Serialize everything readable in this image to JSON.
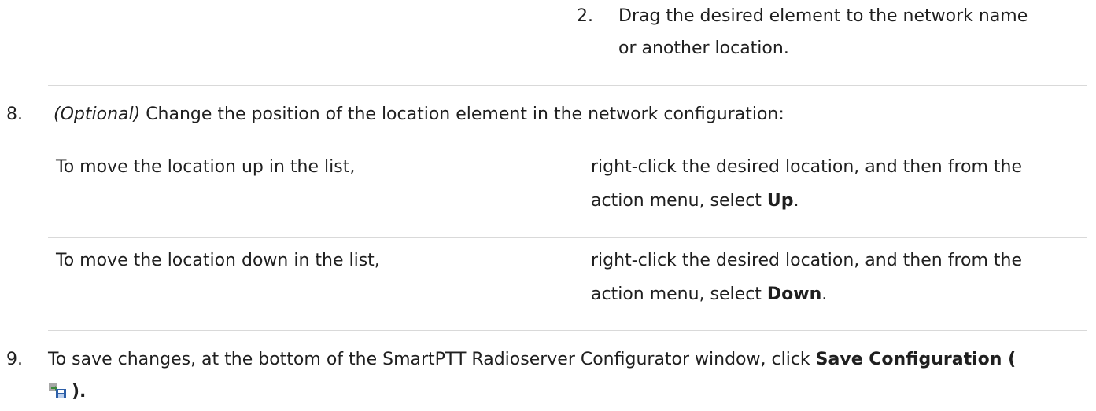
{
  "step2": {
    "number": "2.",
    "line1": "Drag the desired element to the network name",
    "line2": "or another location."
  },
  "step8": {
    "number": "8.",
    "optional": "(Optional)",
    "text": "Change the position of the location element in the network configuration:"
  },
  "table": {
    "rows": [
      {
        "left": "To move the location up in the list,",
        "right_line1": "right-click the desired location, and then from the",
        "right_line2_prefix": "action menu, select ",
        "right_bold": "Up",
        "right_suffix": "."
      },
      {
        "left": "To move the location down in the list,",
        "right_line1": "right-click the desired location, and then from the",
        "right_line2_prefix": "action menu, select ",
        "right_bold": "Down",
        "right_suffix": "."
      }
    ]
  },
  "step9": {
    "number": "9.",
    "text": "To save changes, at the bottom of the SmartPTT Radioserver Configurator window, click ",
    "bold": "Save Configuration (",
    "icon": "save-configuration-icon",
    "close": ").",
    "icon_colors": {
      "blue": "#2d5fa8",
      "arrow": "#3a8a3a",
      "grey": "#a7a7a7"
    }
  }
}
